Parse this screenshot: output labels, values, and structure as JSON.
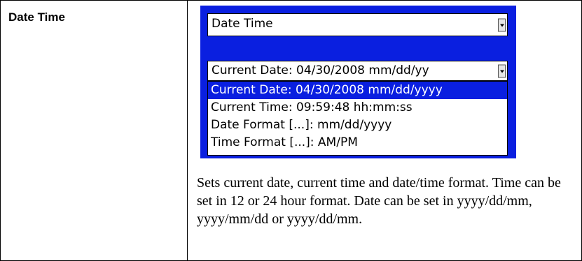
{
  "row": {
    "label": "Date Time",
    "screen": {
      "main_combo_value": "Date Time",
      "sub_combo_value": "Current Date: 04/30/2008 mm/dd/yy",
      "list_options": [
        "Current Date: 04/30/2008 mm/dd/yyyy",
        "Current Time: 09:59:48 hh:mm:ss",
        "Date Format [...]: mm/dd/yyyy",
        "Time Format [...]: AM/PM"
      ],
      "selected_index": 0,
      "colors": {
        "screen_background": "#0a1fe0",
        "selection_highlight": "#0a1fe0"
      }
    },
    "description": "Sets current date, current time and date/time format. Time can be set in 12 or 24 hour format. Date can be set in yyyy/dd/mm, yyyy/mm/dd or yyyy/dd/mm."
  }
}
